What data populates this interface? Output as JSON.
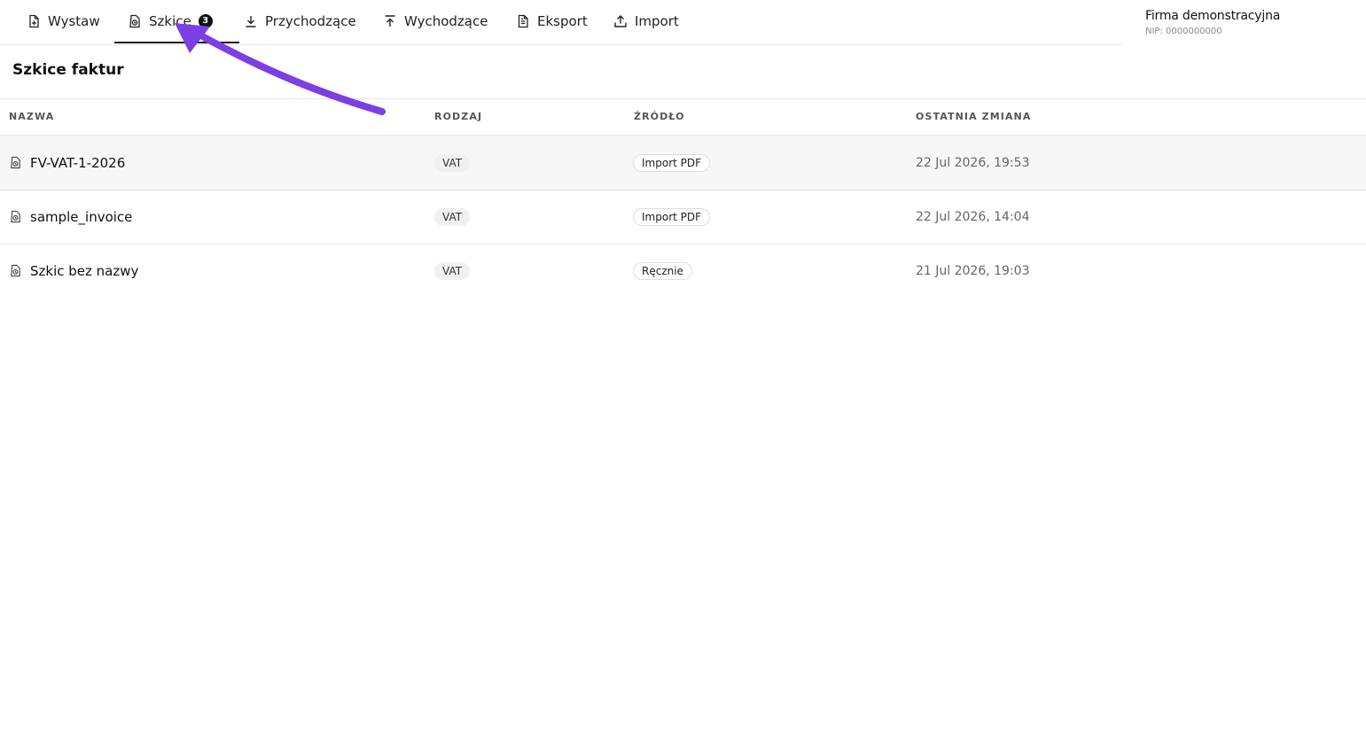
{
  "nav": {
    "tabs": [
      {
        "label": "Wystaw"
      },
      {
        "label": "Szkice",
        "badge": "3"
      },
      {
        "label": "Przychodzące"
      },
      {
        "label": "Wychodzące"
      },
      {
        "label": "Eksport"
      },
      {
        "label": "Import"
      }
    ],
    "active_tab": "Szkice"
  },
  "company": {
    "name": "Firma demonstracyjna",
    "nip": "NIP: 0000000000"
  },
  "page": {
    "title": "Szkice faktur"
  },
  "table": {
    "columns": [
      "NAZWA",
      "RODZAJ",
      "ŹRÓDŁO",
      "OSTATNIA ZMIANA"
    ],
    "rows": [
      {
        "name": "FV-VAT-1-2026",
        "type": "VAT",
        "source": "Import PDF",
        "modified": "22 Jul 2026, 19:53"
      },
      {
        "name": "sample_invoice",
        "type": "VAT",
        "source": "Import PDF",
        "modified": "22 Jul 2026, 14:04"
      },
      {
        "name": "Szkic bez nazwy",
        "type": "VAT",
        "source": "Ręcznie",
        "modified": "21 Jul 2026, 19:03"
      }
    ]
  },
  "colors": {
    "annotation_arrow": "#7b3fe4",
    "active_underline": "#111111"
  },
  "icons": {
    "tab_wystaw": "file-plus-icon",
    "tab_szkice": "draft-icon",
    "tab_przychodzace": "download-icon",
    "tab_wychodzace": "upload-icon",
    "tab_eksport": "file-text-icon",
    "tab_import": "import-icon",
    "row": "draft-icon"
  }
}
